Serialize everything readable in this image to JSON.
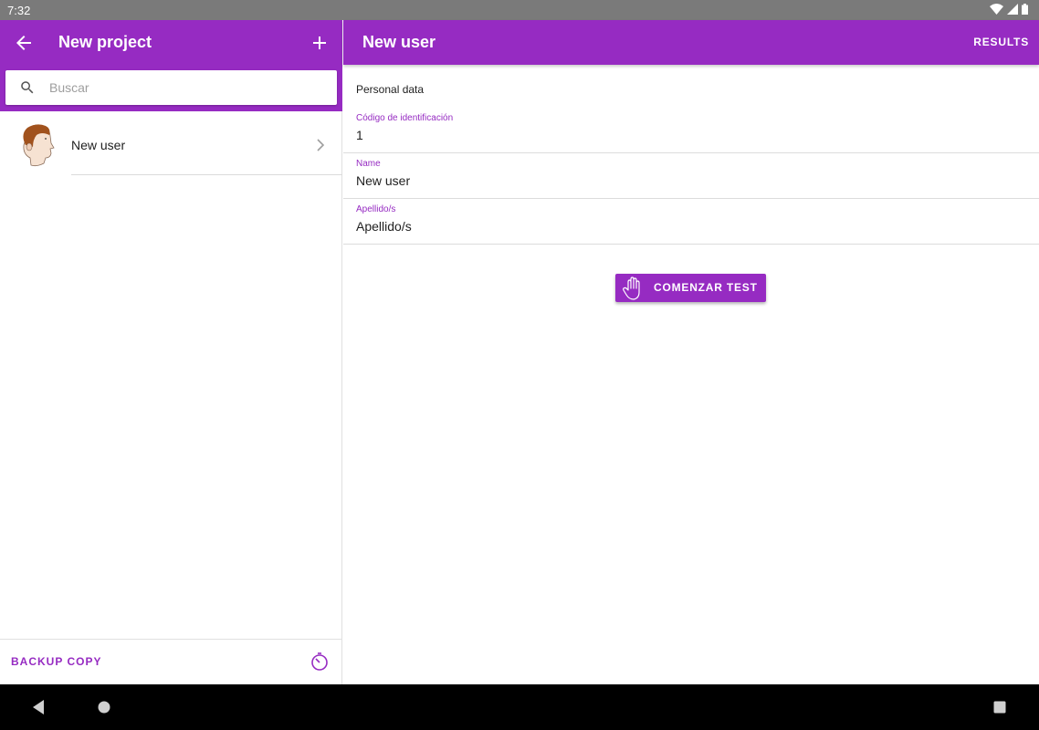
{
  "status_bar": {
    "time": "7:32"
  },
  "left_pane": {
    "title": "New project",
    "search": {
      "placeholder": "Buscar",
      "value": ""
    },
    "users": [
      {
        "name": "New user"
      }
    ],
    "footer": {
      "backup_label": "BACKUP COPY"
    }
  },
  "right_pane": {
    "title": "New user",
    "results_label": "RESULTS",
    "section_label": "Personal data",
    "fields": [
      {
        "label": "Código de identificación",
        "value": "1"
      },
      {
        "label": "Name",
        "value": "New user"
      },
      {
        "label": "Apellido/s",
        "value": "Apellido/s"
      }
    ],
    "start_button_label": "COMENZAR TEST"
  },
  "colors": {
    "accent": "#962bc2",
    "status_bar": "#7a7a7a",
    "nav_bar": "#000000"
  },
  "icons": [
    "wifi-icon",
    "signal-icon",
    "battery-icon",
    "back-arrow-icon",
    "plus-icon",
    "search-icon",
    "avatar-head-icon",
    "chevron-right-icon",
    "timer-icon",
    "hand-icon",
    "nav-back-icon",
    "nav-home-icon",
    "nav-recent-icon"
  ]
}
